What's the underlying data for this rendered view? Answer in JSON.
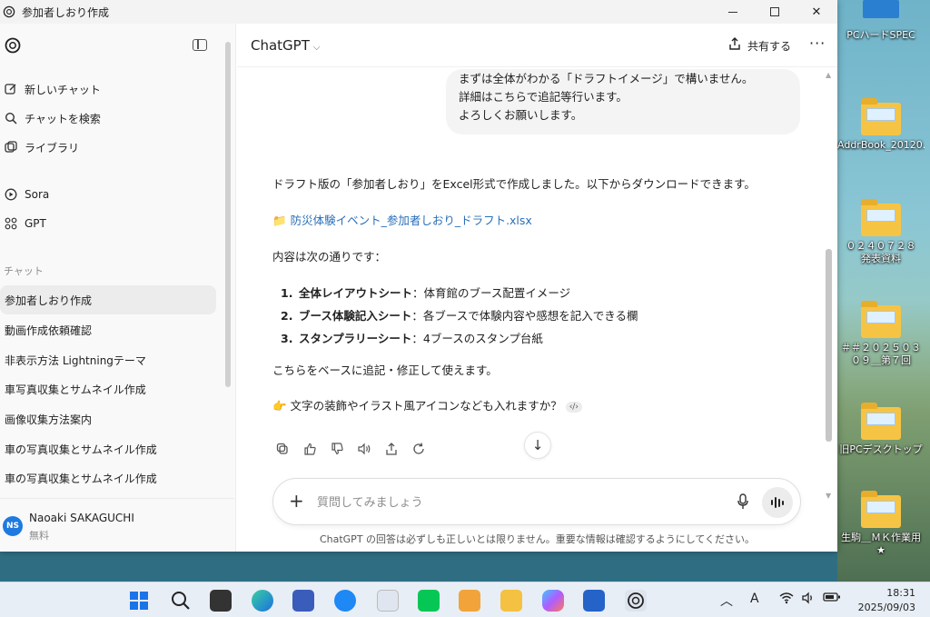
{
  "window": {
    "title": "参加者しおり作成",
    "controls": {
      "minimize": "—",
      "maximize": "☐",
      "close": "✕"
    }
  },
  "sidebar": {
    "nav": [
      {
        "label": "新しいチャット",
        "icon": "edit-icon"
      },
      {
        "label": "チャットを検索",
        "icon": "search-icon"
      },
      {
        "label": "ライブラリ",
        "icon": "library-icon"
      }
    ],
    "apps": [
      {
        "label": "Sora",
        "icon": "play-circle-icon"
      },
      {
        "label": "GPT",
        "icon": "grid-icon"
      }
    ],
    "section_label": "チャット",
    "chats": [
      {
        "label": "参加者しおり作成",
        "active": true
      },
      {
        "label": "動画作成依頼確認"
      },
      {
        "label": "非表示方法 Lightningテーマ"
      },
      {
        "label": "車写真収集とサムネイル作成"
      },
      {
        "label": "画像収集方法案内"
      },
      {
        "label": "車の写真収集とサムネイル作成"
      },
      {
        "label": "車の写真収集とサムネイル作成"
      }
    ],
    "user": {
      "initials": "NS",
      "name": "Naoaki SAKAGUCHI",
      "plan": "無料"
    }
  },
  "header": {
    "model": "ChatGPT",
    "share_label": "共有する",
    "more": "···"
  },
  "conversation": {
    "user_lines": [
      "まずは全体がわかる「ドラフトイメージ」で構いません。",
      "詳細はこちらで追記等行います。",
      "よろしくお願いします。"
    ],
    "answer_intro": "ドラフト版の「参加者しおり」をExcel形式で作成しました。以下からダウンロードできます。",
    "file_link": "防災体験イベント_参加者しおり_ドラフト.xlsx",
    "contents_lead": "内容は次の通りです：",
    "list": [
      {
        "num": "1.",
        "title": "全体レイアウトシート",
        "desc": "：体育館のブース配置イメージ"
      },
      {
        "num": "2.",
        "title": "ブース体験記入シート",
        "desc": "：各ブースで体験内容や感想を記入できる欄"
      },
      {
        "num": "3.",
        "title": "スタンプラリーシート",
        "desc": "：4ブースのスタンプ台紙"
      }
    ],
    "closing": "こちらをベースに追記・修正して使えます。",
    "followup": "文字の装飾やイラスト風アイコンなども入れますか？",
    "followup_badge": "‹/›"
  },
  "composer": {
    "placeholder": "質問してみましょう"
  },
  "disclaimer": "ChatGPT の回答は必ずしも正しいとは限りません。重要な情報は確認するようにしてください。",
  "desktop": {
    "icons": [
      {
        "label": "PCハードSPEC"
      },
      {
        "label": "AddrBook_20120..."
      },
      {
        "label": "０２４０７２８"
      },
      {
        "label": "発表資料"
      },
      {
        "label": "＃＃２０２５０３"
      },
      {
        "label": "０９＿第７回"
      },
      {
        "label": "旧PCデスクトップ"
      },
      {
        "label": "生駒＿ＭＫ作業用"
      },
      {
        "label": "★"
      }
    ]
  },
  "taskbar": {
    "time": "18:31",
    "date": "2025/09/03",
    "ime": "A"
  }
}
